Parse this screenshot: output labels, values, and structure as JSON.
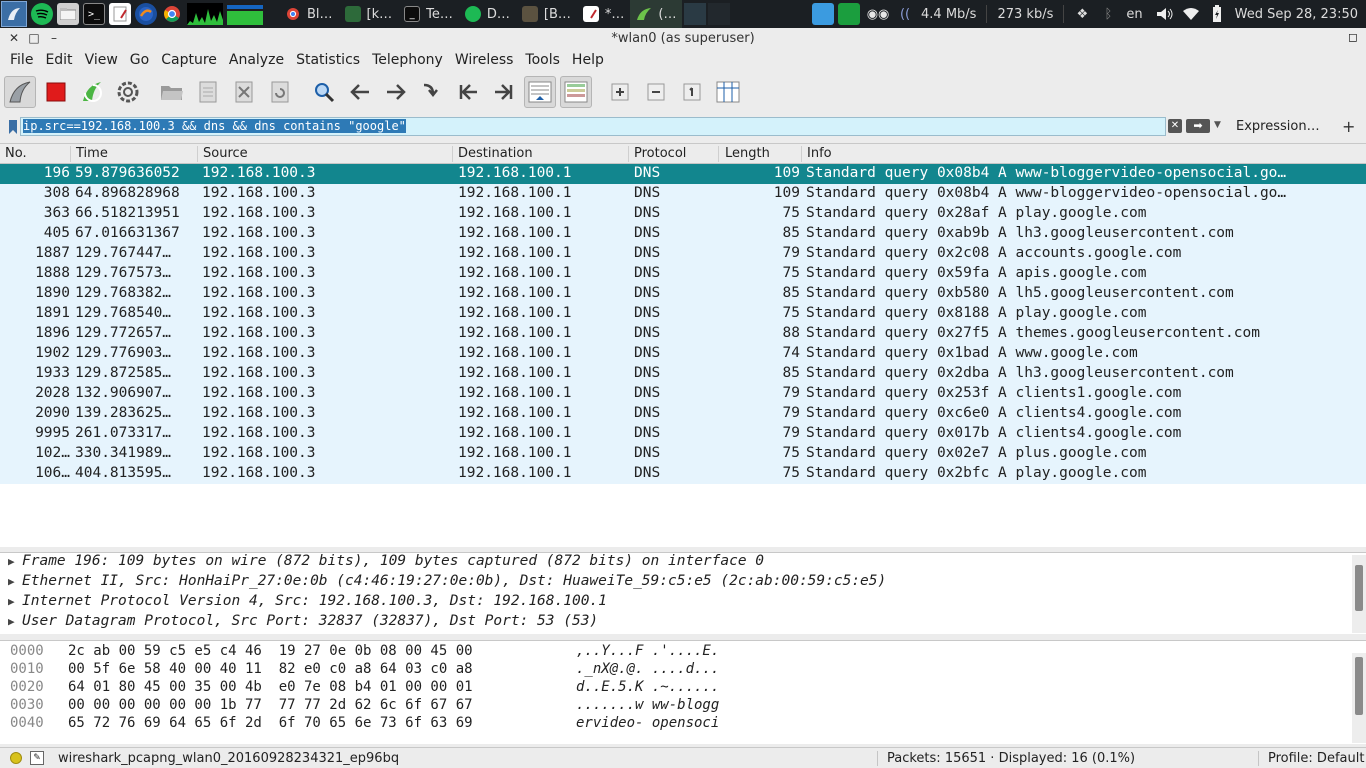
{
  "panel": {
    "tasks": [
      {
        "label": "Bl…",
        "icon": "chrome-icon"
      },
      {
        "label": "[k…",
        "icon": "folder-icon"
      },
      {
        "label": "Te…",
        "icon": "terminal-icon"
      },
      {
        "label": "D…",
        "icon": "spotify-icon"
      },
      {
        "label": "[B…",
        "icon": "folder-icon"
      },
      {
        "label": "*…",
        "icon": "document-icon"
      },
      {
        "label": "(…",
        "icon": "wireshark-icon"
      }
    ],
    "download_speed": "4.4 Mb/s",
    "upload_speed": "273 kb/s",
    "keyboard_layout": "en",
    "datetime": "Wed Sep 28, 23:50"
  },
  "window": {
    "title": "*wlan0 (as superuser)"
  },
  "menu": [
    "File",
    "Edit",
    "View",
    "Go",
    "Capture",
    "Analyze",
    "Statistics",
    "Telephony",
    "Wireless",
    "Tools",
    "Help"
  ],
  "filter": {
    "value": "ip.src==192.168.100.3 && dns && dns contains \"google\"",
    "expression_label": "Expression…",
    "add_label": "+"
  },
  "columns": {
    "no": "No.",
    "time": "Time",
    "source": "Source",
    "destination": "Destination",
    "protocol": "Protocol",
    "length": "Length",
    "info": "Info"
  },
  "packets": [
    {
      "no": "196",
      "time": "59.879636052",
      "src": "192.168.100.3",
      "dst": "192.168.100.1",
      "proto": "DNS",
      "len": "109",
      "info": "Standard query 0x08b4 A www-bloggervideo-opensocial.go…"
    },
    {
      "no": "308",
      "time": "64.896828968",
      "src": "192.168.100.3",
      "dst": "192.168.100.1",
      "proto": "DNS",
      "len": "109",
      "info": "Standard query 0x08b4 A www-bloggervideo-opensocial.go…"
    },
    {
      "no": "363",
      "time": "66.518213951",
      "src": "192.168.100.3",
      "dst": "192.168.100.1",
      "proto": "DNS",
      "len": "75",
      "info": "Standard query 0x28af A play.google.com"
    },
    {
      "no": "405",
      "time": "67.016631367",
      "src": "192.168.100.3",
      "dst": "192.168.100.1",
      "proto": "DNS",
      "len": "85",
      "info": "Standard query 0xab9b A lh3.googleusercontent.com"
    },
    {
      "no": "1887",
      "time": "129.767447…",
      "src": "192.168.100.3",
      "dst": "192.168.100.1",
      "proto": "DNS",
      "len": "79",
      "info": "Standard query 0x2c08 A accounts.google.com"
    },
    {
      "no": "1888",
      "time": "129.767573…",
      "src": "192.168.100.3",
      "dst": "192.168.100.1",
      "proto": "DNS",
      "len": "75",
      "info": "Standard query 0x59fa A apis.google.com"
    },
    {
      "no": "1890",
      "time": "129.768382…",
      "src": "192.168.100.3",
      "dst": "192.168.100.1",
      "proto": "DNS",
      "len": "85",
      "info": "Standard query 0xb580 A lh5.googleusercontent.com"
    },
    {
      "no": "1891",
      "time": "129.768540…",
      "src": "192.168.100.3",
      "dst": "192.168.100.1",
      "proto": "DNS",
      "len": "75",
      "info": "Standard query 0x8188 A play.google.com"
    },
    {
      "no": "1896",
      "time": "129.772657…",
      "src": "192.168.100.3",
      "dst": "192.168.100.1",
      "proto": "DNS",
      "len": "88",
      "info": "Standard query 0x27f5 A themes.googleusercontent.com"
    },
    {
      "no": "1902",
      "time": "129.776903…",
      "src": "192.168.100.3",
      "dst": "192.168.100.1",
      "proto": "DNS",
      "len": "74",
      "info": "Standard query 0x1bad A www.google.com"
    },
    {
      "no": "1933",
      "time": "129.872585…",
      "src": "192.168.100.3",
      "dst": "192.168.100.1",
      "proto": "DNS",
      "len": "85",
      "info": "Standard query 0x2dba A lh3.googleusercontent.com"
    },
    {
      "no": "2028",
      "time": "132.906907…",
      "src": "192.168.100.3",
      "dst": "192.168.100.1",
      "proto": "DNS",
      "len": "79",
      "info": "Standard query 0x253f A clients1.google.com"
    },
    {
      "no": "2090",
      "time": "139.283625…",
      "src": "192.168.100.3",
      "dst": "192.168.100.1",
      "proto": "DNS",
      "len": "79",
      "info": "Standard query 0xc6e0 A clients4.google.com"
    },
    {
      "no": "9995",
      "time": "261.073317…",
      "src": "192.168.100.3",
      "dst": "192.168.100.1",
      "proto": "DNS",
      "len": "79",
      "info": "Standard query 0x017b A clients4.google.com"
    },
    {
      "no": "102…",
      "time": "330.341989…",
      "src": "192.168.100.3",
      "dst": "192.168.100.1",
      "proto": "DNS",
      "len": "75",
      "info": "Standard query 0x02e7 A plus.google.com"
    },
    {
      "no": "106…",
      "time": "404.813595…",
      "src": "192.168.100.3",
      "dst": "192.168.100.1",
      "proto": "DNS",
      "len": "75",
      "info": "Standard query 0x2bfc A play.google.com"
    }
  ],
  "selected_packet_index": 0,
  "details": [
    "Frame 196: 109 bytes on wire (872 bits), 109 bytes captured (872 bits) on interface 0",
    "Ethernet II, Src: HonHaiPr_27:0e:0b (c4:46:19:27:0e:0b), Dst: HuaweiTe_59:c5:e5 (2c:ab:00:59:c5:e5)",
    "Internet Protocol Version 4, Src: 192.168.100.3, Dst: 192.168.100.1",
    "User Datagram Protocol, Src Port: 32837 (32837), Dst Port: 53 (53)"
  ],
  "bytes": [
    {
      "offset": "0000",
      "hex": "2c ab 00 59 c5 e5 c4 46  19 27 0e 0b 08 00 45 00",
      "ascii": ",..Y...F .'....E."
    },
    {
      "offset": "0010",
      "hex": "00 5f 6e 58 40 00 40 11  82 e0 c0 a8 64 03 c0 a8",
      "ascii": "._nX@.@. ....d..."
    },
    {
      "offset": "0020",
      "hex": "64 01 80 45 00 35 00 4b  e0 7e 08 b4 01 00 00 01",
      "ascii": "d..E.5.K .~......"
    },
    {
      "offset": "0030",
      "hex": "00 00 00 00 00 00 1b 77  77 77 2d 62 6c 6f 67 67",
      "ascii": ".......w ww-blogg"
    },
    {
      "offset": "0040",
      "hex": "65 72 76 69 64 65 6f 2d  6f 70 65 6e 73 6f 63 69",
      "ascii": "ervideo- opensoci"
    }
  ],
  "status": {
    "filename": "wireshark_pcapng_wlan0_20160928234321_ep96bq",
    "packets": "Packets: 15651 · Displayed: 16 (0.1%)",
    "profile": "Profile: Default"
  },
  "colors": {
    "selected_row": "#12868e",
    "row_bg": "#e6f4fd",
    "filter_bg": "#d4f2fb",
    "panel_bg": "#1b1f23"
  }
}
